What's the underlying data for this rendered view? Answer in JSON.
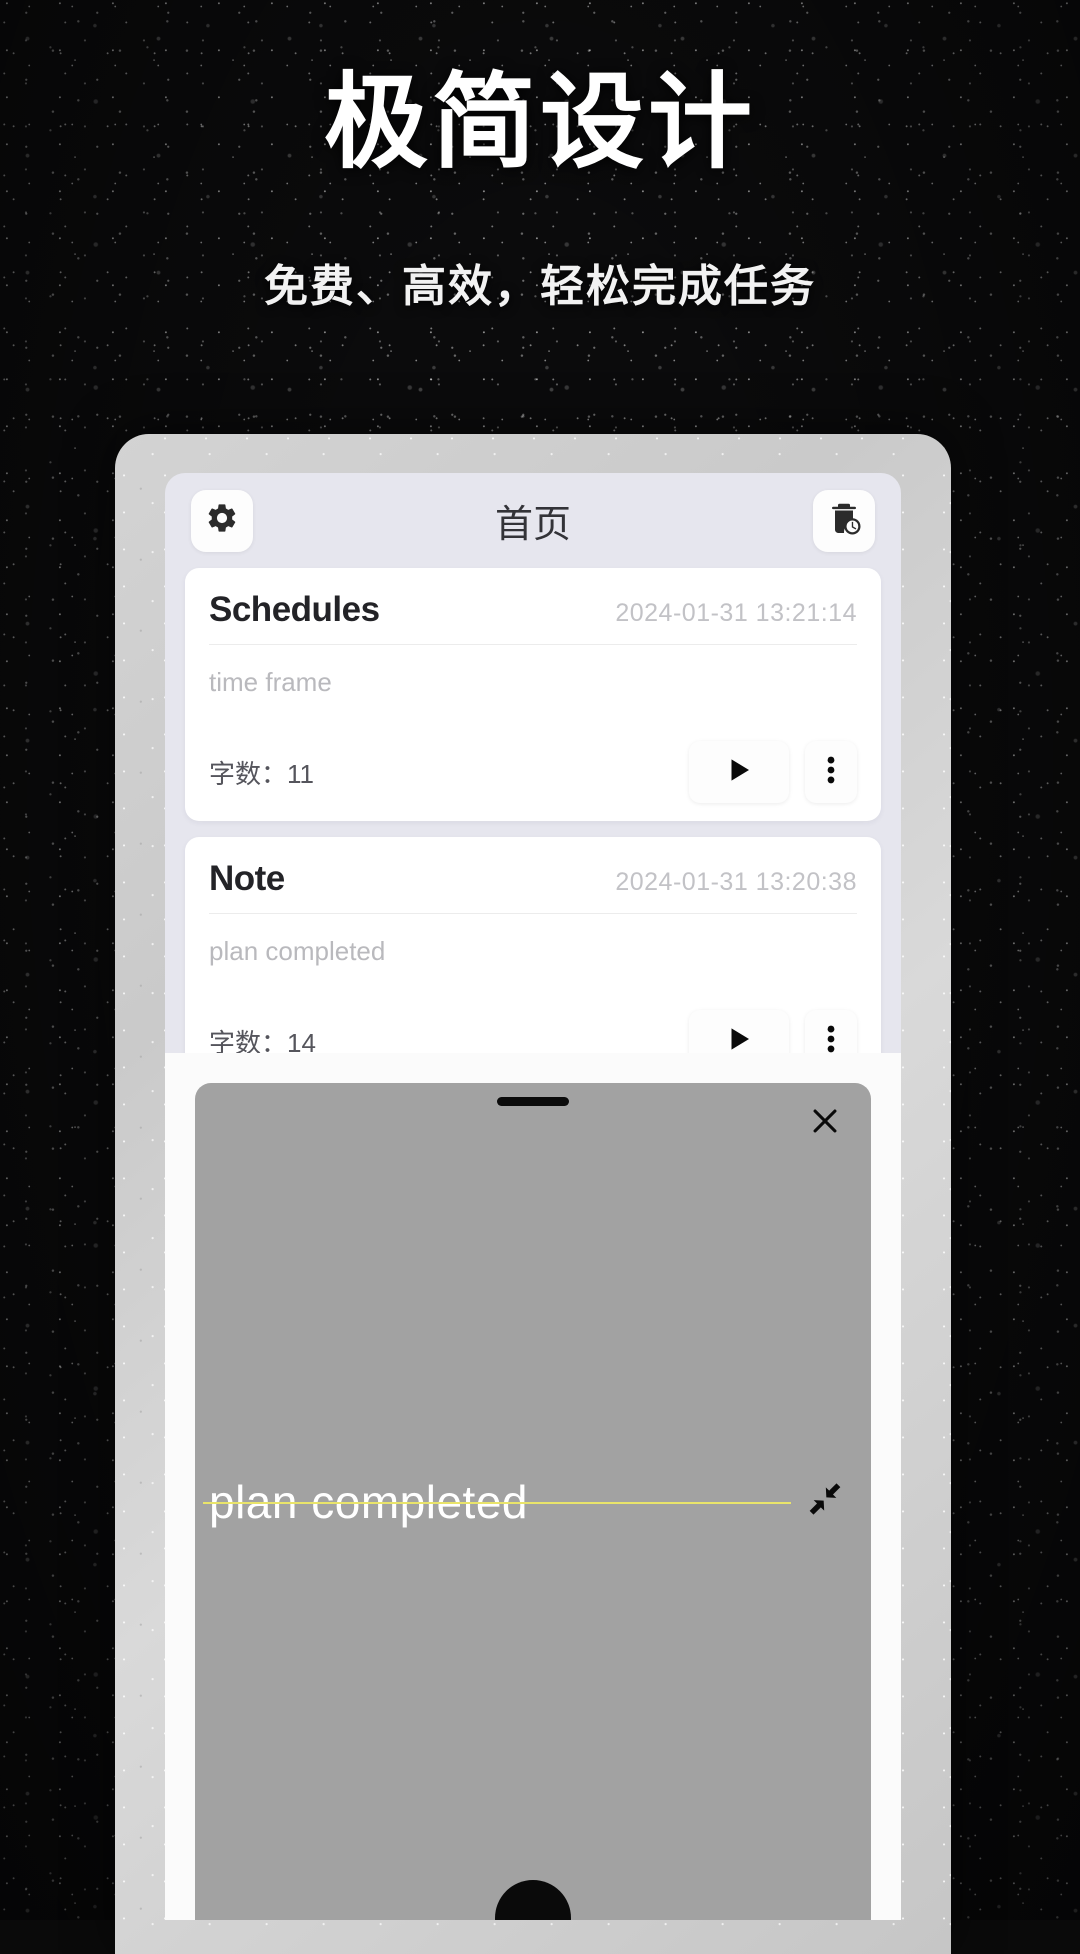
{
  "promo": {
    "headline": "极简设计",
    "subhead": "免费、高效，轻松完成任务"
  },
  "app": {
    "appbar": {
      "settings_icon": "gear-icon",
      "title": "首页",
      "recycle_icon": "trash-clock-icon"
    },
    "notes": [
      {
        "title": "Schedules",
        "timestamp": "2024-01-31 13:21:14",
        "body": "time frame",
        "wordcount_label": "字数：11",
        "play_icon": "play-icon",
        "more_icon": "more-vertical-icon"
      },
      {
        "title": "Note",
        "timestamp": "2024-01-31 13:20:38",
        "body": "plan completed",
        "wordcount_label": "字数：14",
        "play_icon": "play-icon",
        "more_icon": "more-vertical-icon"
      }
    ],
    "sheet": {
      "handle": "drag-handle",
      "close_icon": "close-icon",
      "todo_text": "plan completed",
      "strike_color": "#e9e46a",
      "collapse_icon": "collapse-arrows-icon"
    }
  }
}
